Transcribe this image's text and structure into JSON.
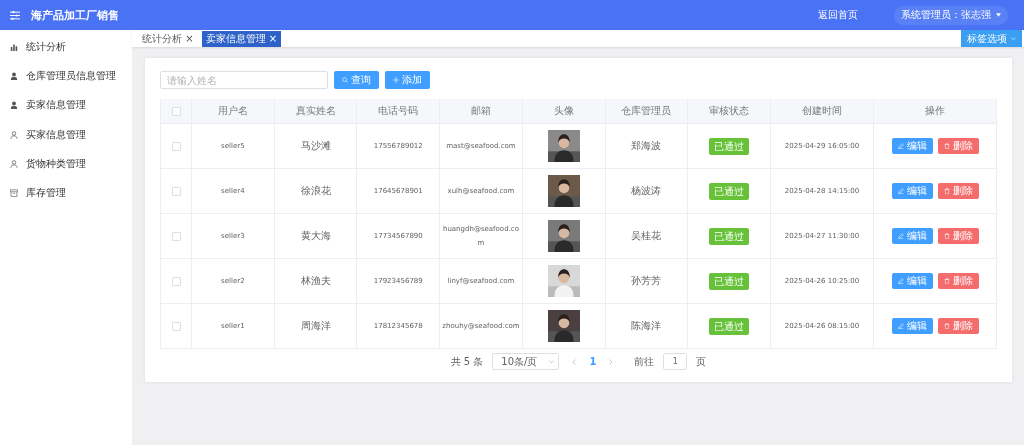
{
  "header": {
    "title": "海产品加工厂销售",
    "home_link": "返回首页",
    "user": "系统管理员：张志强"
  },
  "sidebar": {
    "items": [
      {
        "label": "统计分析",
        "kind": "chart",
        "selected": false
      },
      {
        "label": "仓库管理员信息管理",
        "kind": "person-filled",
        "selected": false
      },
      {
        "label": "卖家信息管理",
        "kind": "person-filled",
        "selected": false
      },
      {
        "label": "买家信息管理",
        "kind": "person",
        "selected": false
      },
      {
        "label": "货物种类管理",
        "kind": "person",
        "selected": false
      },
      {
        "label": "库存管理",
        "kind": "box",
        "selected": false
      }
    ]
  },
  "tabs": [
    {
      "label": "统计分析",
      "close": "×",
      "selected": false
    },
    {
      "label": "卖家信息管理",
      "close": "×",
      "selected": true
    }
  ],
  "tab_options": "标签选项",
  "search": {
    "placeholder": "请输入姓名"
  },
  "buttons": {
    "query": "查询",
    "add": "添加"
  },
  "table": {
    "select_all_checked": false,
    "columns": [
      "用户名",
      "真实姓名",
      "电话号码",
      "邮箱",
      "头像",
      "仓库管理员",
      "审核状态",
      "创建时间",
      "操作"
    ],
    "rows": [
      {
        "checked": false,
        "username": "seller5",
        "real_name": "马沙滩",
        "phone": "17556789012",
        "email": "mast@seafood.com",
        "manager": "郑海波",
        "status": "已通过",
        "created": "2025-04-29 16:05:00",
        "edit": "编辑",
        "delete": "删除"
      },
      {
        "checked": false,
        "username": "seller4",
        "real_name": "徐浪花",
        "phone": "17645678901",
        "email": "xulh@seafood.com",
        "manager": "杨波涛",
        "status": "已通过",
        "created": "2025-04-28 14:15:00",
        "edit": "编辑",
        "delete": "删除"
      },
      {
        "checked": false,
        "username": "seller3",
        "real_name": "黄大海",
        "phone": "17734567890",
        "email": "huangdh@seafood.com",
        "manager": "吴桂花",
        "status": "已通过",
        "created": "2025-04-27 11:30:00",
        "edit": "编辑",
        "delete": "删除"
      },
      {
        "checked": false,
        "username": "seller2",
        "real_name": "林渔夫",
        "phone": "17923456789",
        "email": "linyf@seafood.com",
        "manager": "孙芳芳",
        "status": "已通过",
        "created": "2025-04-26 10:25:00",
        "edit": "编辑",
        "delete": "删除"
      },
      {
        "checked": false,
        "username": "seller1",
        "real_name": "周海洋",
        "phone": "17812345678",
        "email": "zhouhy@seafood.com",
        "manager": "陈海洋",
        "status": "已通过",
        "created": "2025-04-26 08:15:00",
        "edit": "编辑",
        "delete": "删除"
      }
    ]
  },
  "pagination": {
    "total": "共 5 条",
    "page_size": "10条/页",
    "current": "1",
    "goto_label": "前往",
    "goto_value": "1",
    "goto_suffix": "页"
  }
}
